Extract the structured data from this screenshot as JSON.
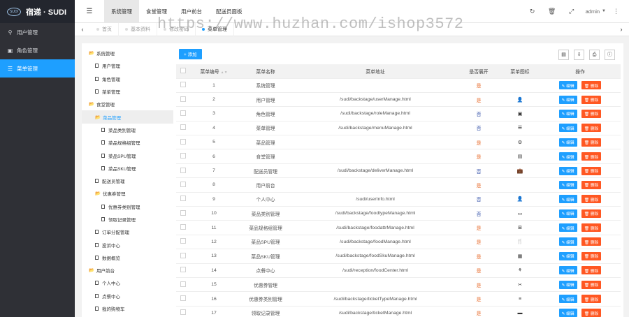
{
  "brand": {
    "logo_text": "SUDI",
    "name": "宿递 · SUDI"
  },
  "sidebar": {
    "items": [
      {
        "label": "用户管理",
        "icon": "user-icon",
        "glyph": "⚲",
        "active": false
      },
      {
        "label": "角色管理",
        "icon": "image-icon",
        "glyph": "▣",
        "active": false
      },
      {
        "label": "菜单管理",
        "icon": "list-icon",
        "glyph": "☰",
        "active": true
      }
    ]
  },
  "topbar": {
    "tabs": [
      {
        "label": "系统管理",
        "active": true
      },
      {
        "label": "食堂管理",
        "active": false
      },
      {
        "label": "用户前台",
        "active": false
      },
      {
        "label": "配送员面板",
        "active": false
      }
    ],
    "user": "admin"
  },
  "pagetabs": [
    {
      "label": "首页",
      "active": false
    },
    {
      "label": "基本资料",
      "active": false
    },
    {
      "label": "修改密码",
      "active": false
    },
    {
      "label": "菜单管理",
      "active": true
    }
  ],
  "watermark": "https://www.huzhan.com/ishop3572",
  "tree": [
    {
      "label": "系统管理",
      "level": 0,
      "type": "folder",
      "active": false
    },
    {
      "label": "用户管理",
      "level": 1,
      "type": "file",
      "active": false
    },
    {
      "label": "角色管理",
      "level": 1,
      "type": "file",
      "active": false
    },
    {
      "label": "菜单管理",
      "level": 1,
      "type": "file",
      "active": false
    },
    {
      "label": "食堂管理",
      "level": 0,
      "type": "folder",
      "active": false
    },
    {
      "label": "菜品管理",
      "level": 1,
      "type": "folder",
      "active": true
    },
    {
      "label": "菜品类别管理",
      "level": 2,
      "type": "file",
      "active": false
    },
    {
      "label": "菜品规格组管理",
      "level": 2,
      "type": "file",
      "active": false
    },
    {
      "label": "菜品SPU管理",
      "level": 2,
      "type": "file",
      "active": false
    },
    {
      "label": "菜品SKU管理",
      "level": 2,
      "type": "file",
      "active": false
    },
    {
      "label": "配送员管理",
      "level": 1,
      "type": "file",
      "active": false
    },
    {
      "label": "优惠券管理",
      "level": 1,
      "type": "folder",
      "active": false
    },
    {
      "label": "优惠券类别管理",
      "level": 2,
      "type": "file",
      "active": false
    },
    {
      "label": "领取记录管理",
      "level": 2,
      "type": "file",
      "active": false
    },
    {
      "label": "订单分配管理",
      "level": 1,
      "type": "file",
      "active": false
    },
    {
      "label": "投诉中心",
      "level": 1,
      "type": "file",
      "active": false
    },
    {
      "label": "数据概览",
      "level": 1,
      "type": "file",
      "active": false
    },
    {
      "label": "用户前台",
      "level": 0,
      "type": "folder",
      "active": false
    },
    {
      "label": "个人中心",
      "level": 1,
      "type": "file",
      "active": false
    },
    {
      "label": "点餐中心",
      "level": 1,
      "type": "file",
      "active": false
    },
    {
      "label": "我的购物车",
      "level": 1,
      "type": "file",
      "active": false
    }
  ],
  "toolbar": {
    "add_label": "+ 添加"
  },
  "table": {
    "headers": [
      "菜单编号",
      "菜单名称",
      "菜单地址",
      "是否展开",
      "菜单图标",
      "操作"
    ],
    "edit_label": "✎ 编辑",
    "delete_label": "🗑 删除",
    "rows": [
      {
        "id": "1",
        "name": "系统管理",
        "url": "",
        "expand": "是",
        "icon": ""
      },
      {
        "id": "2",
        "name": "用户管理",
        "url": "/sudi/backstage/userManage.html",
        "expand": "是",
        "icon": "👤"
      },
      {
        "id": "3",
        "name": "角色管理",
        "url": "/sudi/backstage/roleManage.html",
        "expand": "否",
        "icon": "▣"
      },
      {
        "id": "4",
        "name": "菜单管理",
        "url": "/sudi/backstage/menuManage.html",
        "expand": "否",
        "icon": "☰"
      },
      {
        "id": "5",
        "name": "菜品管理",
        "url": "",
        "expand": "是",
        "icon": "⚙"
      },
      {
        "id": "6",
        "name": "食堂管理",
        "url": "",
        "expand": "是",
        "icon": "▤"
      },
      {
        "id": "7",
        "name": "配送员管理",
        "url": "/sudi/backstage/deliverManage.html",
        "expand": "否",
        "icon": "💼"
      },
      {
        "id": "8",
        "name": "用户前台",
        "url": "",
        "expand": "是",
        "icon": ""
      },
      {
        "id": "9",
        "name": "个人中心",
        "url": "/sudi/userInfo.html",
        "expand": "否",
        "icon": "👤"
      },
      {
        "id": "10",
        "name": "菜品类别管理",
        "url": "/sudi/backstage/foodtypeManage.html",
        "expand": "否",
        "icon": "▭"
      },
      {
        "id": "11",
        "name": "菜品规格组管理",
        "url": "/sudi/backstage/foodattrManage.html",
        "expand": "是",
        "icon": "⊞"
      },
      {
        "id": "12",
        "name": "菜品SPU管理",
        "url": "/sudi/backstage/foodManage.html",
        "expand": "是",
        "icon": "🍴"
      },
      {
        "id": "13",
        "name": "菜品SKU管理",
        "url": "/sudi/backstage/foodSkuManage.html",
        "expand": "是",
        "icon": "▦"
      },
      {
        "id": "14",
        "name": "点餐中心",
        "url": "/sudi/reception/foodCenter.html",
        "expand": "是",
        "icon": "⚘"
      },
      {
        "id": "15",
        "name": "优惠券管理",
        "url": "",
        "expand": "是",
        "icon": "✂"
      },
      {
        "id": "16",
        "name": "优惠券类别管理",
        "url": "/sudi/backstage/ticketTypeManage.html",
        "expand": "是",
        "icon": "≡"
      },
      {
        "id": "17",
        "name": "领取记录管理",
        "url": "/sudi/backstage/ticketManage.html",
        "expand": "是",
        "icon": "▬"
      }
    ]
  }
}
